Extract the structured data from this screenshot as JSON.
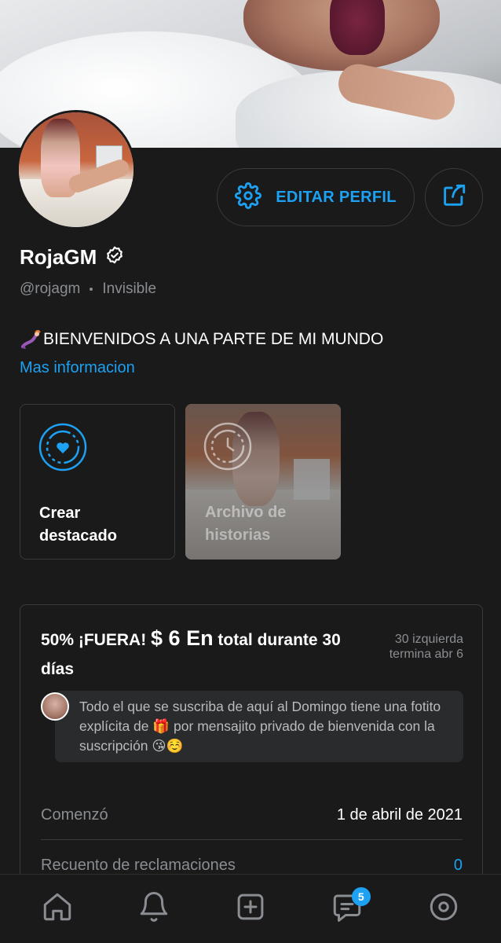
{
  "profile": {
    "name": "RojaGM",
    "handle": "@rojagm",
    "status": "Invisible",
    "bio": "BIENVENIDOS A UNA PARTE DE MI MUNDO",
    "more_info": "Mas informacion",
    "edit_label": "EDITAR PERFIL"
  },
  "highlights": [
    {
      "label": "Crear destacado",
      "icon": "heart-story-icon"
    },
    {
      "label": "Archivo de historias",
      "icon": "clock-history-icon"
    }
  ],
  "promo": {
    "title_prefix": "50% ¡FUERA! ",
    "price": "$ 6 En",
    "title_suffix": " total durante 30 días",
    "side_info": "30 izquierda termina abr 6",
    "message": "Todo el que se suscriba de aquí al Domingo tiene una fotito explícita de 🎁 por mensajito privado de bienvenida con la suscripción 😘☺️",
    "started_label": "Comenzó",
    "started_value": "1 de abril de 2021",
    "claims_label": "Recuento de reclamaciones",
    "claims_value": "0"
  },
  "nav": {
    "items": [
      "home-icon",
      "bell-icon",
      "add-icon",
      "messages-icon",
      "profile-icon"
    ],
    "messages_badge": "5"
  },
  "colors": {
    "background": "#1a1a1b",
    "accent": "#1da1f2",
    "muted": "#8a8d91",
    "border": "#3a3a3c"
  }
}
